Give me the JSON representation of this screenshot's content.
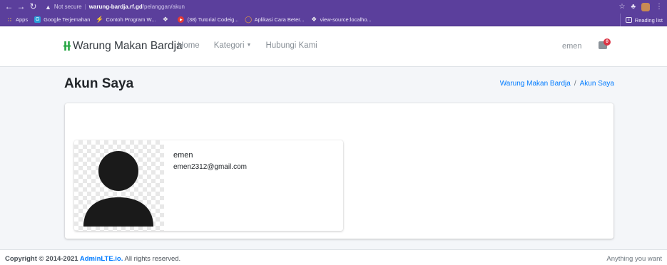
{
  "browser": {
    "security_label": "Not secure",
    "url_host": "warung-bardja.rf.gd",
    "url_path": "/pelanggan/akun",
    "bookmarks": [
      {
        "label": "Apps",
        "icon": "apps-grid-icon"
      },
      {
        "label": "Google Terjemahan",
        "icon": "google-translate-icon"
      },
      {
        "label": "Contoh Program W...",
        "icon": "bolt-icon"
      },
      {
        "label": "",
        "icon": "chrome-icon"
      },
      {
        "label": "(38) Tutorial Codeig...",
        "icon": "youtube-icon"
      },
      {
        "label": "Aplikasi Cara Beter...",
        "icon": "ring-icon"
      },
      {
        "label": "view-source:localho...",
        "icon": "chrome-icon"
      }
    ],
    "reading_list": "Reading list"
  },
  "navbar": {
    "brand": "Warung Makan Bardja",
    "links": [
      "Home",
      "Kategori",
      "Hubungi Kami"
    ],
    "user": "emen",
    "cart_count": "0"
  },
  "header": {
    "title": "Akun Saya",
    "breadcrumb": [
      "Warung Makan Bardja",
      "Akun Saya"
    ]
  },
  "profile": {
    "name": "emen",
    "email": "emen2312@gmail.com"
  },
  "footer": {
    "copyright_prefix": "Copyright © 2014-2021 ",
    "copyright_link": "AdminLTE.io.",
    "copyright_suffix": " All rights reserved.",
    "right_text": "Anything you want"
  }
}
